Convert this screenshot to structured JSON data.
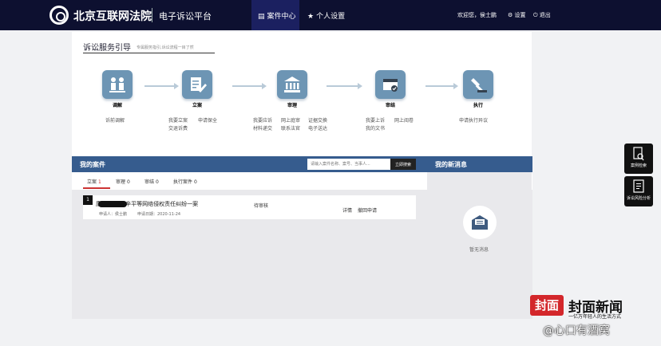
{
  "header": {
    "brand": "北京互联网法院",
    "subbrand": "电子诉讼平台",
    "nav": [
      {
        "label": "案件中心",
        "active": true
      },
      {
        "label": "个人设置",
        "active": false
      }
    ],
    "welcome": "欢迎您，侯士鹏",
    "settings": "设置",
    "logout": "退出"
  },
  "guide": {
    "title": "诉讼服务引导",
    "subtitle": "专属服务指引,诉讼流程一目了然",
    "steps": [
      {
        "label": "调解",
        "icon": "people-icon",
        "links": [
          "诉前调解"
        ]
      },
      {
        "label": "立案",
        "icon": "document-edit-icon",
        "links": [
          "我要立案",
          "申请保全",
          "交退诉费"
        ]
      },
      {
        "label": "审理",
        "icon": "courthouse-icon",
        "links": [
          "我要应诉",
          "网上庭审",
          "证据交换",
          "材料递交",
          "联系法官",
          "电子送达"
        ]
      },
      {
        "label": "审结",
        "icon": "case-closed-icon",
        "links": [
          "我要上诉",
          "网上阅卷",
          "我的文书"
        ]
      },
      {
        "label": "执行",
        "icon": "gavel-icon",
        "links": [
          "申请执行异议"
        ]
      }
    ]
  },
  "cases": {
    "title": "我的案件",
    "search_placeholder": "请输入案件名称、案号、当事人...",
    "search_button": "立即搜索",
    "tabs": [
      {
        "label": "立案",
        "count": "1"
      },
      {
        "label": "审理",
        "count": "0"
      },
      {
        "label": "审结",
        "count": "0"
      },
      {
        "label": "执行案件",
        "count": "0"
      }
    ],
    "rows": [
      {
        "num": "1",
        "title": "康▇▇▇等与辛平等网络侵权责任纠纷一案",
        "applicant": "申请人：侯士鹏",
        "date": "申请日期：2020-11-24",
        "status": "待审核",
        "detail": "详情",
        "withdraw": "撤回申请"
      }
    ]
  },
  "messages": {
    "title": "我的新消息",
    "empty": "暂无消息"
  },
  "sidebar": [
    {
      "label": "案例检索",
      "icon": "case-search-icon"
    },
    {
      "label": "诉讼风险分析",
      "icon": "risk-analysis-icon"
    }
  ],
  "watermark": {
    "logo": "封面",
    "title": "封面新闻",
    "slogan": "一亿万年轻人的生活方式",
    "weibo": "@心口有酒窝"
  },
  "colors": {
    "topbar": "#0d1030",
    "accent": "#365c8e",
    "step_icon": "#6d95b4",
    "tab_active": "#cc3333",
    "watermark": "#d3272b"
  }
}
